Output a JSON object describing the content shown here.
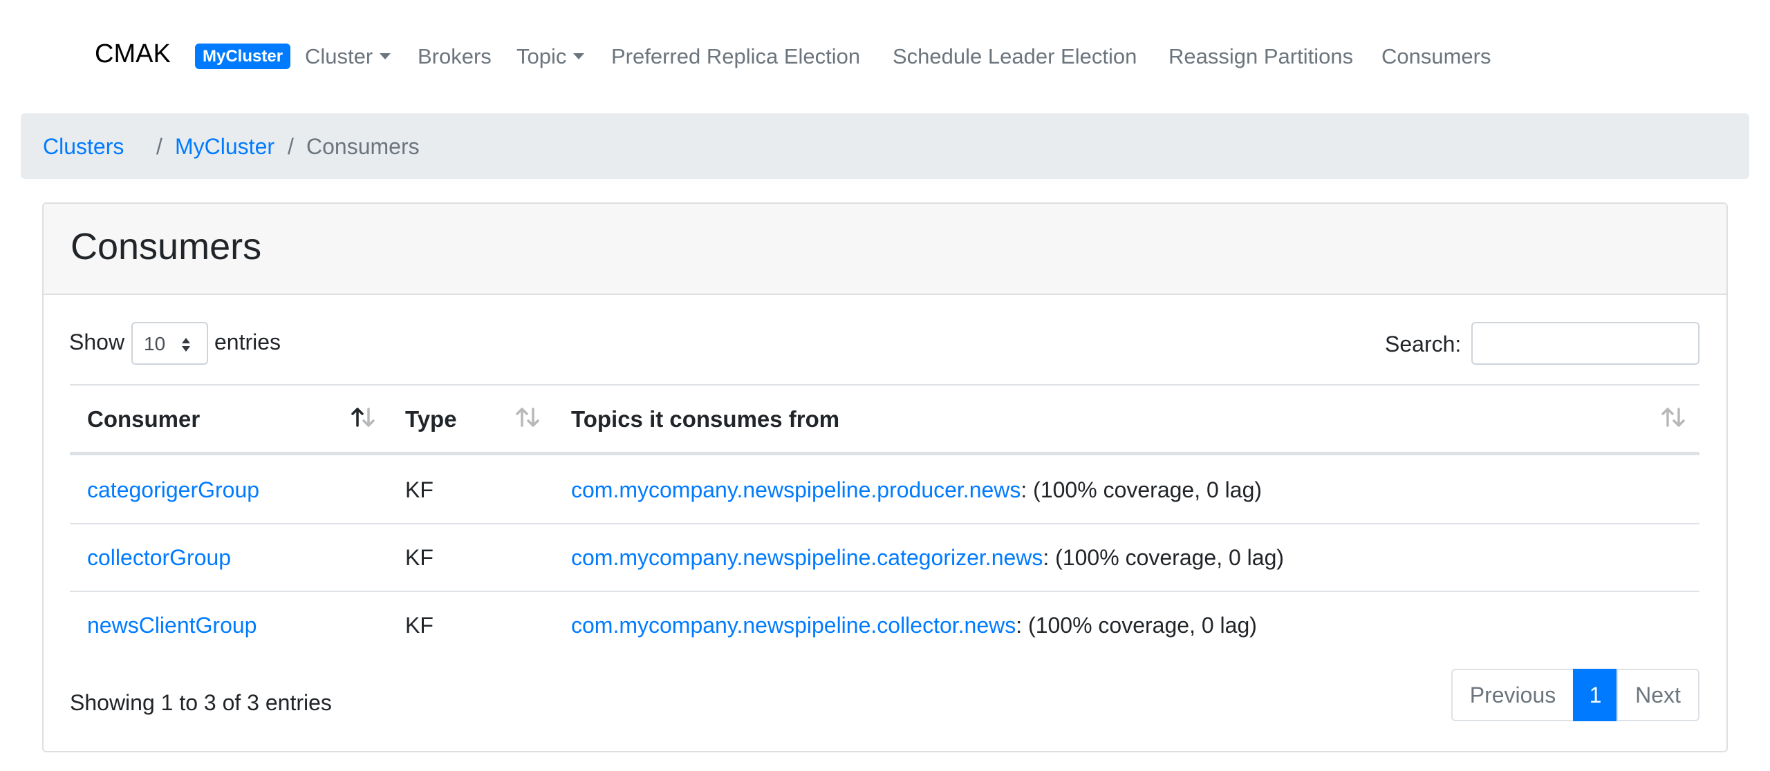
{
  "navbar": {
    "brand": "CMAK",
    "cluster_badge": "MyCluster",
    "items": [
      {
        "label": "Cluster",
        "dropdown": true
      },
      {
        "label": "Brokers",
        "dropdown": false
      },
      {
        "label": "Topic",
        "dropdown": true
      },
      {
        "label": "Preferred Replica Election",
        "dropdown": false
      },
      {
        "label": "Schedule Leader Election",
        "dropdown": false
      },
      {
        "label": "Reassign Partitions",
        "dropdown": false
      },
      {
        "label": "Consumers",
        "dropdown": false
      }
    ]
  },
  "breadcrumb": {
    "items": [
      "Clusters",
      "MyCluster",
      "Consumers"
    ],
    "separator": "/"
  },
  "card": {
    "title": "Consumers"
  },
  "table_controls": {
    "show_label": "Show",
    "page_size": "10",
    "entries_label": "entries",
    "search_label": "Search:",
    "search_value": ""
  },
  "table": {
    "columns": [
      "Consumer",
      "Type",
      "Topics it consumes from"
    ],
    "rows": [
      {
        "consumer": "categorigerGroup",
        "type": "KF",
        "topic": "com.mycompany.newspipeline.producer.news",
        "detail": ": (100% coverage, 0 lag)"
      },
      {
        "consumer": "collectorGroup",
        "type": "KF",
        "topic": "com.mycompany.newspipeline.categorizer.news",
        "detail": ": (100% coverage, 0 lag)"
      },
      {
        "consumer": "newsClientGroup",
        "type": "KF",
        "topic": "com.mycompany.newspipeline.collector.news",
        "detail": ": (100% coverage, 0 lag)"
      }
    ]
  },
  "footer": {
    "info": "Showing 1 to 3 of 3 entries",
    "previous": "Previous",
    "current_page": "1",
    "next": "Next"
  },
  "colors": {
    "accent": "#007bff",
    "muted": "#6c757d",
    "breadcrumb_bg": "#e9ecef",
    "card_header_bg": "#f7f7f7"
  },
  "icons": {
    "sort_active": "sort-ascending-icon",
    "sort_inactive": "sort-both-icon",
    "select_spinner": "up-down-arrows-icon",
    "dropdown": "caret-down-icon"
  }
}
